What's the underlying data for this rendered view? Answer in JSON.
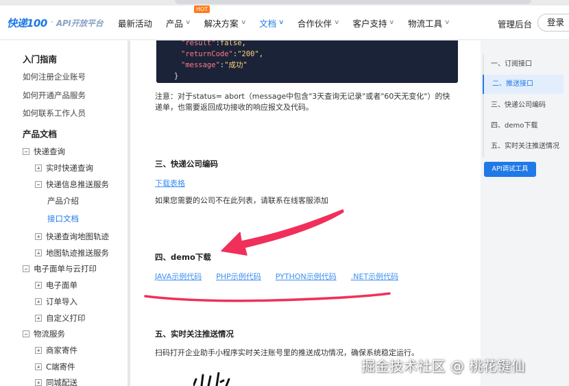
{
  "header": {
    "logo_brand": "快递100",
    "logo_sub": "API开放平台",
    "hot_badge": "HOT",
    "nav": [
      {
        "label": "最新活动"
      },
      {
        "label": "产品"
      },
      {
        "label": "解决方案"
      },
      {
        "label": "文档"
      },
      {
        "label": "合作伙伴"
      },
      {
        "label": "客户支持"
      },
      {
        "label": "物流工具"
      }
    ],
    "admin": "管理后台",
    "login": "登录"
  },
  "sidebar": {
    "intro_title": "入门指南",
    "intro_links": [
      "如何注册企业账号",
      "如何开通产品服务",
      "如何联系工作人员"
    ],
    "docs_title": "产品文档",
    "tree": {
      "express_query": "快递查询",
      "realtime_query": "实时快递查询",
      "push_service": "快递信息推送服务",
      "product_intro": "产品介绍",
      "api_doc": "接口文档",
      "map_track": "快递查询地图轨迹",
      "map_push": "地图轨迹推送服务",
      "eorder_cloud": "电子面单与云打印",
      "eorder": "电子面单",
      "order_import": "订单导入",
      "custom_print": "自定义打印",
      "logistics": "物流服务",
      "merchant_send": "商家寄件",
      "c_send": "C端寄件",
      "same_city": "同城配送"
    }
  },
  "doc": {
    "code": {
      "line1_key": "\"result\"",
      "line1_sep": ":",
      "line1_val": "false",
      "line1_end": ",",
      "line2_key": "\"returnCode\"",
      "line2_sep": ":",
      "line2_val": "\"200\"",
      "line2_end": ",",
      "line3_key": "\"message\"",
      "line3_sep": ":",
      "line3_val": "\"成功\"",
      "close": "}"
    },
    "note": "注意：对于status= abort（message中包含\"3天查询无记录\"或者\"60天无变化\"）的快递单，也需要返回成功接收的响应报文及代码。",
    "section3_title": "三、快递公司编码",
    "download_link": "下载表格",
    "section3_text": "如果您需要的公司不在此列表，请联系在线客服添加",
    "section4_title": "四、demo下载",
    "demo_links": [
      "JAVA示例代码",
      "PHP示例代码",
      "PYTHON示例代码",
      ".NET示例代码"
    ],
    "section5_title": "五、实时关注推送情况",
    "section5_text": "扫码打开企业助手小程序实时关注账号里的推送成功情况，确保系统稳定运行。"
  },
  "toc": {
    "items": [
      "一、订阅接口",
      "二、推送接口",
      "三、快递公司编码",
      "四、demo下载",
      "五、实时关注推送情况"
    ],
    "active_index": 1,
    "api_button": "API调试工具"
  },
  "watermark": "掘金技术社区 @ 桃花键仙",
  "colors": {
    "accent": "#1f79e6",
    "annotation": "#f0305a",
    "code_bg": "#1b2338",
    "hot": "#ff7a1a"
  }
}
